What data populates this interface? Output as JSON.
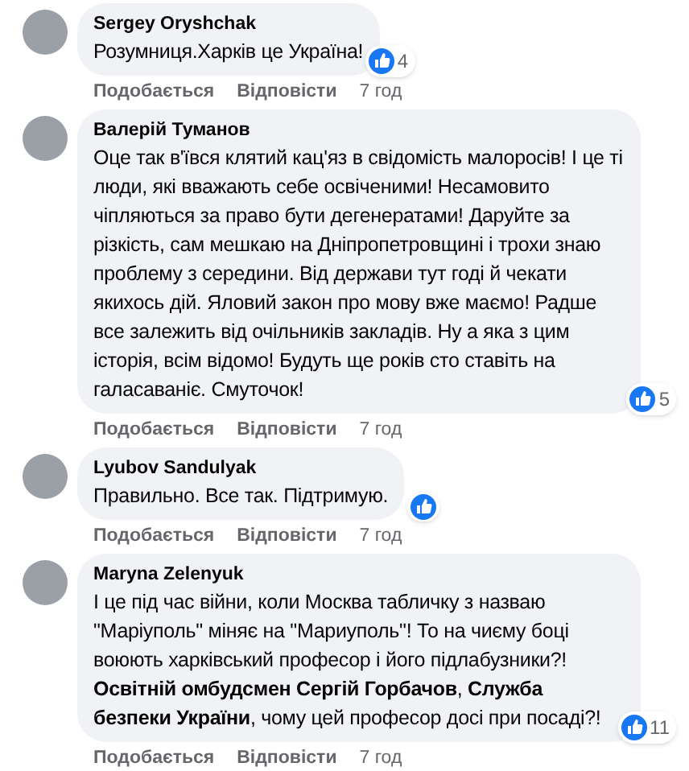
{
  "comments": [
    {
      "author": "Sergey Oryshchak",
      "text": "Розумниця.Харків це Україна!",
      "reactions": "4",
      "actions": [
        "Подобається",
        "Відповісти"
      ],
      "time": "7 год"
    },
    {
      "author": "Валерій Туманов",
      "text": "Оце так в'ївся клятий кац'яз в свідомість малоросів! І це ті люди, які вважають себе освіченими! Несамовито чіпляються за право бути дегенератами! Даруйте за різкість, сам мешкаю на Дніпропетровщині і трохи знаю проблему з середини. Від держави тут годі й чекати якихось дій. Яловий закон про мову вже маємо! Радше все залежить від очільників закладів. Ну а яка з цим історія, всім відомо! Будуть ще років сто ставіть на галасаваніє. Смуточок!",
      "reactions": "5",
      "actions": [
        "Подобається",
        "Відповісти"
      ],
      "time": "7 год"
    },
    {
      "author": "Lyubov Sandulyak",
      "text": "Правильно. Все так. Підтримую.",
      "actions": [
        "Подобається",
        "Відповісти"
      ],
      "time": "7 год"
    },
    {
      "author": "Maryna Zelenyuk",
      "text": "І це під час війни, коли Москва табличку з назваю \"Маріуполь\" міняє на \"Мариуполь\"! То на чиєму боці воюють харківський професор і його підлабузники?! **Освітній омбудсмен Сергій Горбачов**, **Служба безпеки України**, чому цей професор досі при посаді?!",
      "reactions": "11",
      "actions": [
        "Подобається",
        "Відповісти"
      ],
      "time": "7 год"
    }
  ]
}
